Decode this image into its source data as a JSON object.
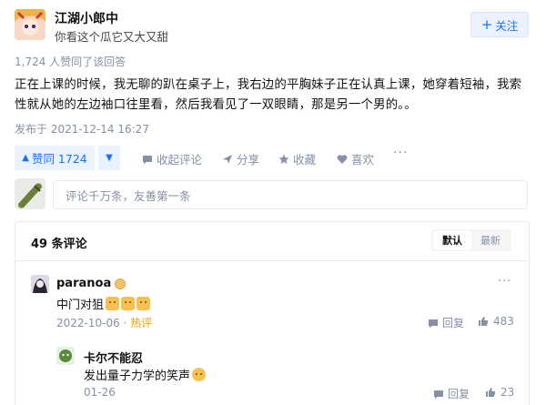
{
  "author": {
    "name": "江湖小郎中",
    "bio": "你看这个瓜它又大又甜",
    "follow_label": "关注",
    "follow_icon": "plus-icon"
  },
  "answer": {
    "upvote_summary": "1,724 人赞同了该回答",
    "content": "正在上课的时候，我无聊的趴在桌子上，我右边的平胸妹子正在认真上课，她穿着短袖，我索性就从她的左边袖口往里看，然后我看见了一双眼睛，那是另一个男的。。",
    "publish_time": "发布于 2021-12-14 16:27"
  },
  "actions": {
    "vote_label": "赞同 1724",
    "comment_label": "收起评论",
    "share_label": "分享",
    "favorite_label": "收藏",
    "like_label": "喜欢",
    "more_label": "···"
  },
  "comment_input": {
    "placeholder": "评论千万条，友善第一条"
  },
  "comments_panel": {
    "count_label": "49 条评论",
    "sort": [
      "默认",
      "最新"
    ],
    "active_sort": "默认"
  },
  "comments": [
    {
      "user": "paranoa",
      "text": "中门对狙",
      "emoji_count": 3,
      "date": "2022-10-06",
      "tag": "热评",
      "reply_label": "回复",
      "likes": "483",
      "more": "···"
    },
    {
      "user": "卡尔不能忍",
      "text": "发出量子力学的笑声",
      "emoji_count": 1,
      "date": "01-26",
      "tag": "",
      "reply_label": "回复",
      "likes": "23",
      "more": "···"
    }
  ],
  "colors": {
    "brand_blue": "#1772f6",
    "muted_gray": "#8590a6",
    "hot_orange": "#f0a000"
  }
}
